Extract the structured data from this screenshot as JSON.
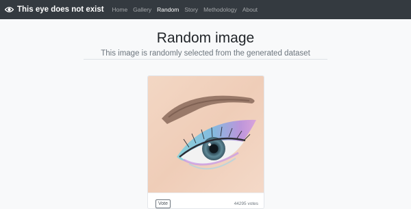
{
  "navbar": {
    "brand": "This eye does not exist",
    "brand_icon": "eye-icon",
    "links": [
      {
        "label": "Home"
      },
      {
        "label": "Gallery"
      },
      {
        "label": "Random",
        "active": true
      },
      {
        "label": "Story"
      },
      {
        "label": "Methodology"
      },
      {
        "label": "About"
      }
    ]
  },
  "main": {
    "title": "Random image",
    "subtitle": "This image is randomly selected from the generated dataset"
  },
  "card": {
    "vote_label": "Vote",
    "votes": "44295 votes"
  },
  "colors": {
    "navbar_bg": "#343a40",
    "page_bg": "#f8f9fa"
  }
}
